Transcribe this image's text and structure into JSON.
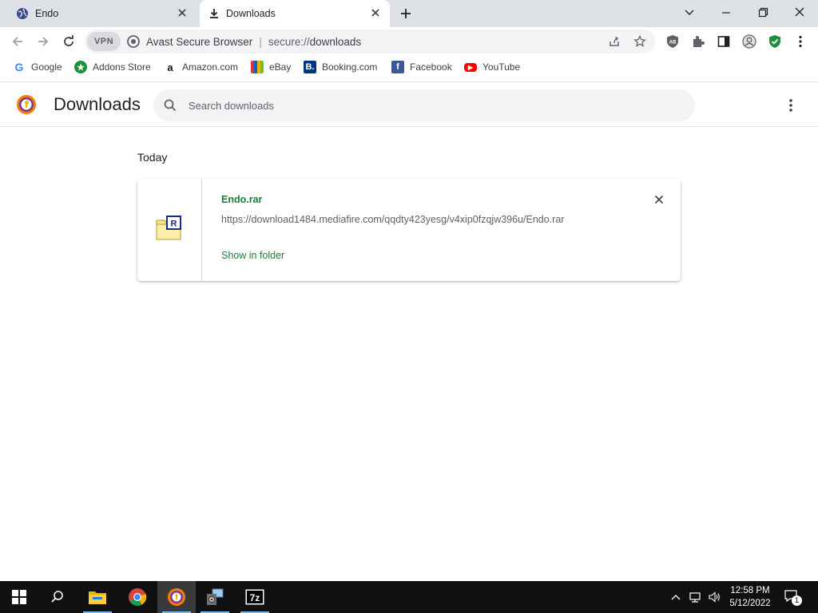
{
  "tabs": [
    {
      "title": "Endo",
      "icon": "globe-icon"
    },
    {
      "title": "Downloads",
      "icon": "download-icon"
    }
  ],
  "toolbar": {
    "vpn_label": "VPN",
    "browser_name": "Avast Secure Browser",
    "url_scheme": "secure://",
    "url_path": "downloads"
  },
  "bookmarks": [
    {
      "label": "Google",
      "icon": "google-icon"
    },
    {
      "label": "Addons Store",
      "icon": "addons-store-icon"
    },
    {
      "label": "Amazon.com",
      "icon": "amazon-icon"
    },
    {
      "label": "eBay",
      "icon": "ebay-icon"
    },
    {
      "label": "Booking.com",
      "icon": "booking-icon"
    },
    {
      "label": "Facebook",
      "icon": "facebook-icon"
    },
    {
      "label": "YouTube",
      "icon": "youtube-icon"
    }
  ],
  "downloads": {
    "title": "Downloads",
    "search_placeholder": "Search downloads",
    "section_label": "Today",
    "items": [
      {
        "file_name": "Endo.rar",
        "url": "https://download1484.mediafire.com/qqdty423yesg/v4xip0fzqjw396u/Endo.rar",
        "action": "Show in folder"
      }
    ]
  },
  "taskbar": {
    "time": "12:58 PM",
    "date": "5/12/2022",
    "notification_count": "1"
  },
  "colors": {
    "accent_green": "#188038",
    "tabstrip_bg": "#dee1e6",
    "omnibox_bg": "#f1f3f4",
    "taskbar_bg": "#101010"
  }
}
